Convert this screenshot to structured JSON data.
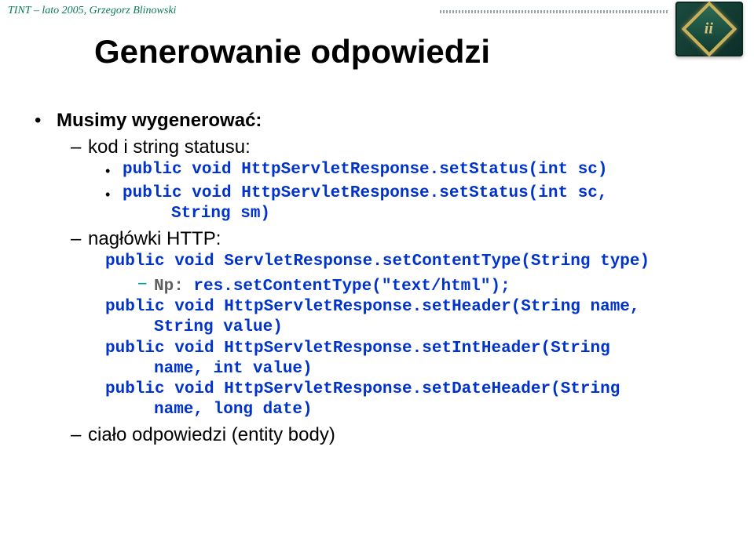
{
  "header": {
    "text": "TINT – lato 2005, Grzegorz Blinowski",
    "logo_letters": "ii"
  },
  "title": "Generowanie odpowiedzi",
  "bullets": {
    "l1": "Musimy wygenerować:",
    "l2a": "kod i string statusu:",
    "code1a": "public void HttpServletResponse.setStatus(int sc)",
    "code1b_line1": "public void HttpServletResponse.setStatus(int sc,",
    "code1b_line2": "String sm)",
    "l2b": "nagłówki HTTP:",
    "code2a": "public void ServletResponse.setContentType(String type)",
    "np_prefix": "Np: ",
    "np_code": "res.setContentType(\"text/html\");",
    "code2b_line1": "public void HttpServletResponse.setHeader(String name,",
    "code2b_line2": "String value)",
    "code2c_line1": "public void HttpServletResponse.setIntHeader(String",
    "code2c_line2": "name, int value)",
    "code2d_line1": "public void HttpServletResponse.setDateHeader(String",
    "code2d_line2": "name, long date)",
    "l2c": "ciało odpowiedzi (entity body)"
  }
}
